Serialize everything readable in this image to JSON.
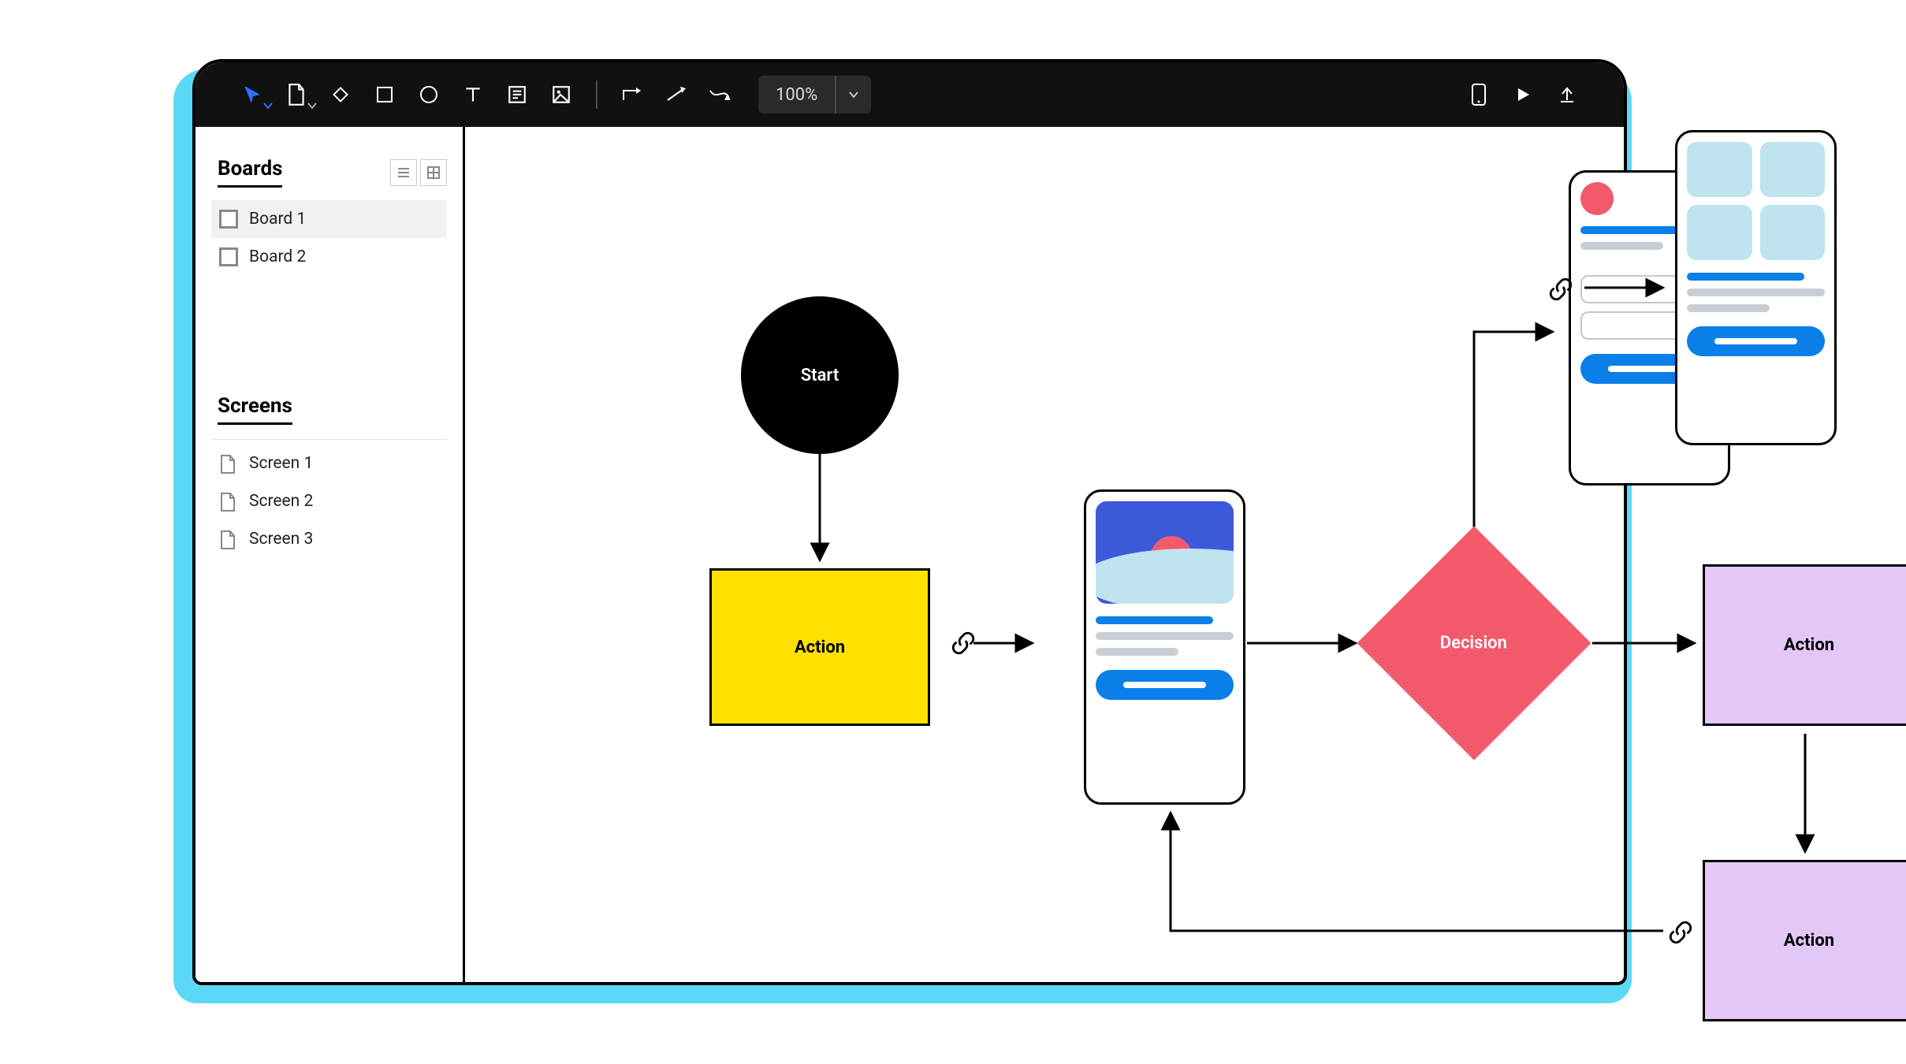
{
  "toolbar": {
    "zoom": "100%"
  },
  "sidebar": {
    "boards": {
      "title": "Boards",
      "items": [
        "Board 1",
        "Board 2"
      ],
      "selected": 0
    },
    "screens": {
      "title": "Screens",
      "items": [
        "Screen 1",
        "Screen 2",
        "Screen 3"
      ]
    }
  },
  "nodes": {
    "start": {
      "label": "Start"
    },
    "action1": {
      "label": "Action"
    },
    "decision": {
      "label": "Decision"
    },
    "action2": {
      "label": "Action"
    },
    "action3": {
      "label": "Action"
    }
  }
}
